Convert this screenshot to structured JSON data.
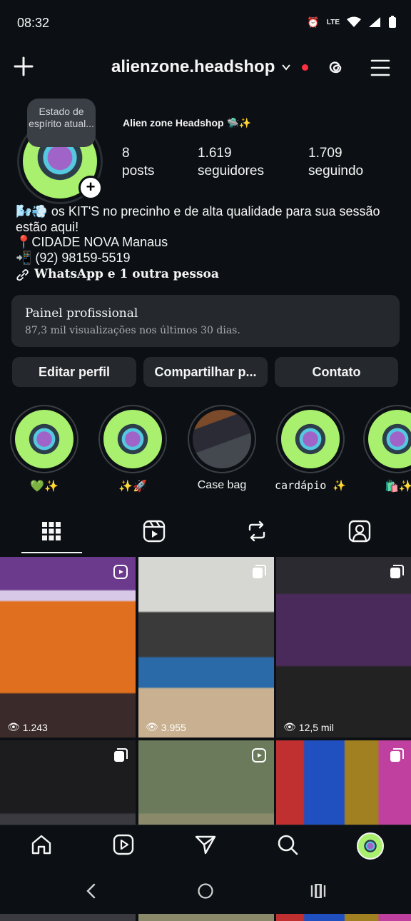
{
  "status_bar": {
    "time": "08:32",
    "network": "LTE"
  },
  "header": {
    "username": "alienzone.headshop"
  },
  "profile": {
    "note_text": "Estado de espírito atual...",
    "display_name": "Alien zone Headshop 🛸✨",
    "stats": [
      {
        "value": "8",
        "label": "posts"
      },
      {
        "value": "1.619",
        "label": "seguidores"
      },
      {
        "value": "1.709",
        "label": "seguindo"
      }
    ],
    "bio": {
      "line1": "🌬️💨 os KIT'S no precinho e de alta qualidade para sua sessão estão aqui!",
      "line2": "📍CIDADE NOVA Manaus",
      "line3": "📲 (92) 98159-5519",
      "link": "WhatsApp e 1 outra pessoa"
    }
  },
  "panel": {
    "title": "Painel profissional",
    "subtitle": "87,3 mil visualizações nos últimos 30 dias."
  },
  "actions": {
    "edit": "Editar perfil",
    "share": "Compartilhar p...",
    "contact": "Contato"
  },
  "highlights": [
    {
      "label": "💚✨"
    },
    {
      "label": "✨🚀"
    },
    {
      "label": "Case bag"
    },
    {
      "label": "cardápio ✨"
    },
    {
      "label": "🛍️✨"
    }
  ],
  "posts": [
    {
      "views": "1.243",
      "type": "reel"
    },
    {
      "views": "3.955",
      "type": "carousel"
    },
    {
      "views": "12,5 mil",
      "type": "carousel"
    },
    {
      "views": "",
      "type": "carousel"
    },
    {
      "views": "",
      "type": "reel"
    },
    {
      "views": "",
      "type": "carousel"
    }
  ],
  "colors": {
    "background": "#0c1014",
    "surface": "#25292e",
    "notification_dot": "#ff3040",
    "accent_green": "#a8f06e"
  }
}
